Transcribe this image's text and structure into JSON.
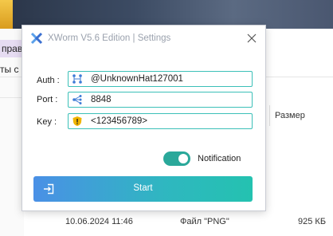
{
  "background": {
    "ribbon_item_1": "правле",
    "ribbon_item_2": "ты с",
    "column_size": "Размер",
    "row": {
      "date": "10.06.2024 11:46",
      "type": "Файл \"PNG\"",
      "size": "925 КБ"
    }
  },
  "dialog": {
    "title": "XWorm V5.6 Edition | Settings",
    "auth": {
      "label": "Auth :",
      "value": "@UnknownHat127001",
      "icon": "network-icon"
    },
    "port": {
      "label": "Port :",
      "value": "8848",
      "icon": "port-tree-icon"
    },
    "key": {
      "label": "Key :",
      "value": "<123456789>",
      "icon": "warning-shield-icon"
    },
    "notification": {
      "label": "Notification",
      "enabled": true
    },
    "start_button": {
      "label": "Start",
      "icon": "login-icon"
    },
    "colors": {
      "accent": "#3cc0b8",
      "toggle_on": "#2aa89a",
      "gradient_start": "#4a90e6",
      "gradient_end": "#24c2b0"
    }
  }
}
